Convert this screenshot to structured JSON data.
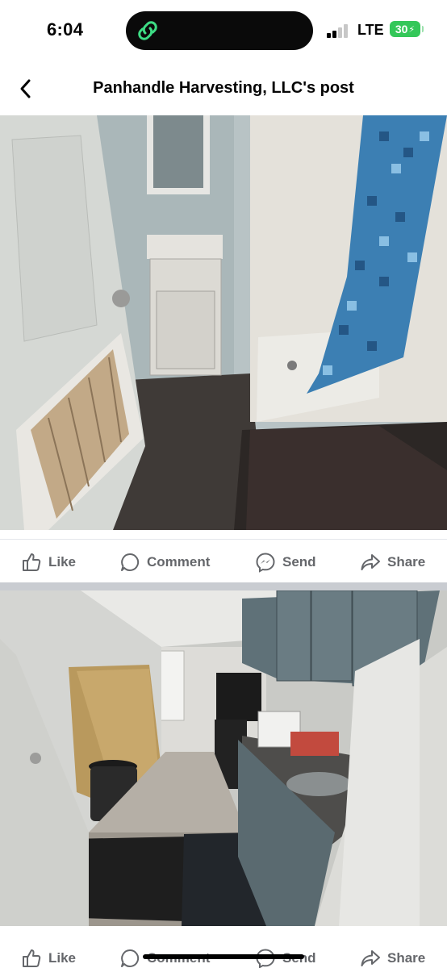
{
  "status_bar": {
    "time": "6:04",
    "network": "LTE",
    "battery": "30",
    "signal_bars_active": 2,
    "signal_bars_total": 4,
    "island_icon": "link-icon",
    "island_color": "#3ddc84"
  },
  "header": {
    "title": "Panhandle Harvesting, LLC's post",
    "back_icon": "chevron-left-icon"
  },
  "post": {
    "photos": [
      {
        "subject": "bathroom"
      },
      {
        "subject": "kitchen"
      }
    ],
    "actions": {
      "like": "Like",
      "comment": "Comment",
      "send": "Send",
      "share": "Share"
    }
  },
  "colors": {
    "text": "#050505",
    "secondary": "#65676b",
    "divider": "#c9ccd1"
  }
}
